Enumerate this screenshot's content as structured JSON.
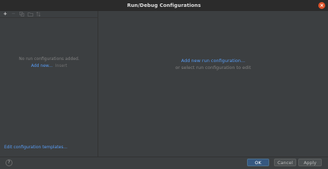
{
  "window": {
    "title": "Run/Debug Configurations",
    "close_glyph": "×"
  },
  "toolbar": {
    "items": [
      {
        "name": "add-icon",
        "glyph": "+"
      },
      {
        "name": "remove-icon",
        "glyph": "−"
      },
      {
        "name": "copy-icon",
        "glyph": "⧉"
      },
      {
        "name": "folder-icon",
        "glyph": "▭"
      },
      {
        "name": "sort-icon",
        "glyph": "⇅"
      }
    ]
  },
  "left_panel": {
    "empty_text": "No run configurations added.",
    "add_new_link": "Add new...",
    "add_new_shortcut": "Insert",
    "edit_templates_link": "Edit configuration templates..."
  },
  "right_panel": {
    "add_link": "Add new run configuration...",
    "hint": "or select run configuration to edit"
  },
  "buttons": {
    "help": "?",
    "ok": "OK",
    "cancel": "Cancel",
    "apply": "Apply"
  },
  "colors": {
    "background": "#3c3f41",
    "titlebar": "#2b2b2b",
    "link": "#589df6",
    "primary_button": "#365880",
    "close_button": "#e0542c"
  }
}
